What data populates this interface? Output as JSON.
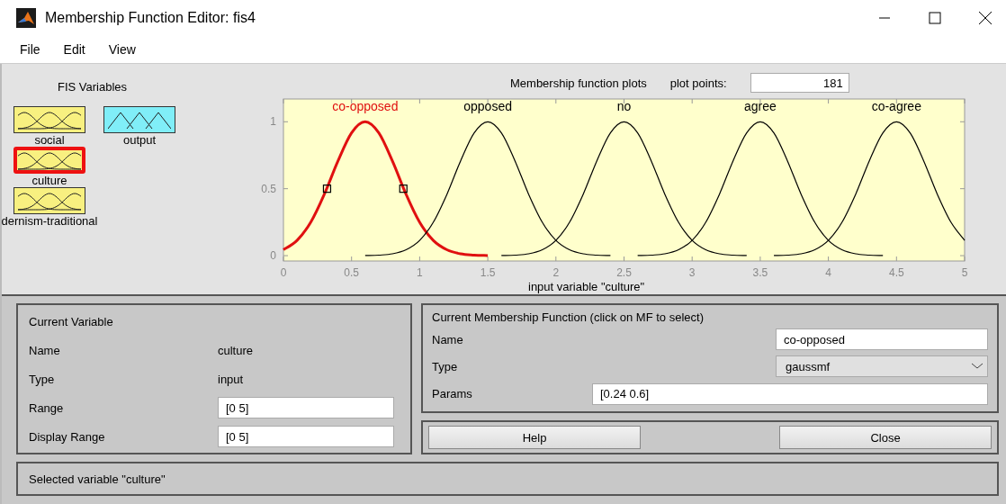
{
  "window": {
    "title": "Membership Function Editor: fis4"
  },
  "menu": [
    "File",
    "Edit",
    "View"
  ],
  "fis_variables": {
    "title": "FIS Variables",
    "items": [
      {
        "name": "social",
        "kind": "input",
        "selected": false
      },
      {
        "name": "output",
        "kind": "output",
        "selected": false
      },
      {
        "name": "culture",
        "kind": "input",
        "selected": true
      },
      {
        "name": "dernism-traditional",
        "kind": "input",
        "selected": false
      }
    ]
  },
  "plot": {
    "title": "Membership function plots",
    "plot_points_label": "plot points:",
    "plot_points": "181",
    "mf_states": [
      {
        "selected": true
      },
      {
        "selected": false
      },
      {
        "selected": false
      },
      {
        "selected": false
      },
      {
        "selected": false
      }
    ],
    "chart_data": {
      "type": "line",
      "xlabel": "input variable \"culture\"",
      "xlim": [
        0,
        5
      ],
      "ylim": [
        -0.04,
        1.17
      ],
      "xticks": [
        0,
        0.5,
        1,
        1.5,
        2,
        2.5,
        3,
        3.5,
        4,
        4.5,
        5
      ],
      "yticks": [
        0,
        0.5,
        1
      ],
      "x": [
        0,
        0.1,
        0.2,
        0.3,
        0.4,
        0.5,
        0.6,
        0.7,
        0.8,
        0.9,
        1,
        1.1,
        1.2,
        1.3,
        1.4,
        1.5,
        1.6,
        1.7,
        1.8,
        1.9,
        2,
        2.1,
        2.2,
        2.3,
        2.4,
        2.5,
        2.6,
        2.7,
        2.8,
        2.9,
        3,
        3.1,
        3.2,
        3.3,
        3.4,
        3.5,
        3.6,
        3.7,
        3.8,
        3.9,
        4,
        4.1,
        4.2,
        4.3,
        4.4,
        4.5,
        4.6,
        4.7,
        4.8,
        4.9,
        5
      ],
      "series": [
        {
          "name": "co-opposed",
          "color": "#e01010",
          "values": [
            0.044,
            0.114,
            0.249,
            0.458,
            0.707,
            0.917,
            1,
            0.917,
            0.707,
            0.458,
            0.249,
            0.114,
            0.044,
            0.014,
            0.004,
            0.001,
            null,
            null,
            null,
            null,
            null,
            null,
            null,
            null,
            null,
            null,
            null,
            null,
            null,
            null,
            null,
            null,
            null,
            null,
            null,
            null,
            null,
            null,
            null,
            null,
            null,
            null,
            null,
            null,
            null,
            null,
            null,
            null,
            null,
            null,
            null
          ]
        },
        {
          "name": "opposed",
          "color": "#000000",
          "values": [
            null,
            null,
            null,
            null,
            null,
            null,
            0.001,
            0.004,
            0.014,
            0.044,
            0.114,
            0.249,
            0.458,
            0.707,
            0.917,
            1,
            0.917,
            0.707,
            0.458,
            0.249,
            0.114,
            0.044,
            0.014,
            0.004,
            0.001,
            null,
            null,
            null,
            null,
            null,
            null,
            null,
            null,
            null,
            null,
            null,
            null,
            null,
            null,
            null,
            null,
            null,
            null,
            null,
            null,
            null,
            null,
            null,
            null,
            null,
            null
          ]
        },
        {
          "name": "no",
          "color": "#000000",
          "values": [
            null,
            null,
            null,
            null,
            null,
            null,
            null,
            null,
            null,
            null,
            null,
            null,
            null,
            null,
            null,
            null,
            0.001,
            0.004,
            0.014,
            0.044,
            0.114,
            0.249,
            0.458,
            0.707,
            0.917,
            1,
            0.917,
            0.707,
            0.458,
            0.249,
            0.114,
            0.044,
            0.014,
            0.004,
            0.001,
            null,
            null,
            null,
            null,
            null,
            null,
            null,
            null,
            null,
            null,
            null,
            null,
            null,
            null,
            null,
            null
          ]
        },
        {
          "name": "agree",
          "color": "#000000",
          "values": [
            null,
            null,
            null,
            null,
            null,
            null,
            null,
            null,
            null,
            null,
            null,
            null,
            null,
            null,
            null,
            null,
            null,
            null,
            null,
            null,
            null,
            null,
            null,
            null,
            null,
            null,
            0.001,
            0.004,
            0.014,
            0.044,
            0.114,
            0.249,
            0.458,
            0.707,
            0.917,
            1,
            0.917,
            0.707,
            0.458,
            0.249,
            0.114,
            0.044,
            0.014,
            0.004,
            0.001,
            null,
            null,
            null,
            null,
            null,
            null
          ]
        },
        {
          "name": "co-agree",
          "color": "#000000",
          "values": [
            null,
            null,
            null,
            null,
            null,
            null,
            null,
            null,
            null,
            null,
            null,
            null,
            null,
            null,
            null,
            null,
            null,
            null,
            null,
            null,
            null,
            null,
            null,
            null,
            null,
            null,
            null,
            null,
            null,
            null,
            null,
            null,
            null,
            null,
            null,
            null,
            0.001,
            0.004,
            0.014,
            0.044,
            0.114,
            0.249,
            0.458,
            0.707,
            0.917,
            1,
            0.917,
            0.707,
            0.458,
            0.249,
            0.114
          ]
        }
      ]
    }
  },
  "current_variable": {
    "title": "Current Variable",
    "name_label": "Name",
    "name": "culture",
    "type_label": "Type",
    "type": "input",
    "range_label": "Range",
    "range": "[0 5]",
    "display_range_label": "Display Range",
    "display_range": "[0 5]"
  },
  "current_mf": {
    "title": "Current Membership Function (click on MF to select)",
    "name_label": "Name",
    "name": "co-opposed",
    "type_label": "Type",
    "type": "gaussmf",
    "params_label": "Params",
    "params": "[0.24 0.6]"
  },
  "buttons": [
    "Help",
    "Close"
  ],
  "status": "Selected variable \"culture\""
}
